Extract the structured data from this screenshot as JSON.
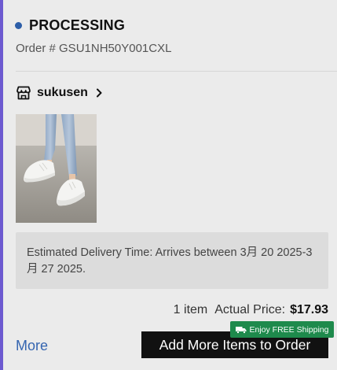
{
  "order": {
    "status": "PROCESSING",
    "status_color": "#2d5ea8",
    "order_number": "Order # GSU1NH50Y001CXL"
  },
  "shop": {
    "name": "sukusen",
    "icon": "store-icon",
    "chevron_icon": "chevron-right-icon"
  },
  "product": {
    "image": "white-sneakers-photo"
  },
  "delivery": {
    "text": "Estimated Delivery Time: Arrives between 3月 20 2025-3月 27 2025."
  },
  "summary": {
    "item_count": "1 item",
    "price_label": "Actual Price:",
    "price": "$17.93"
  },
  "actions": {
    "more_label": "More",
    "add_items_label": "Add More Items to Order",
    "shipping_badge": "Enjoy FREE Shipping",
    "shipping_badge_color": "#1e8a4c",
    "shipping_icon": "truck-icon"
  }
}
